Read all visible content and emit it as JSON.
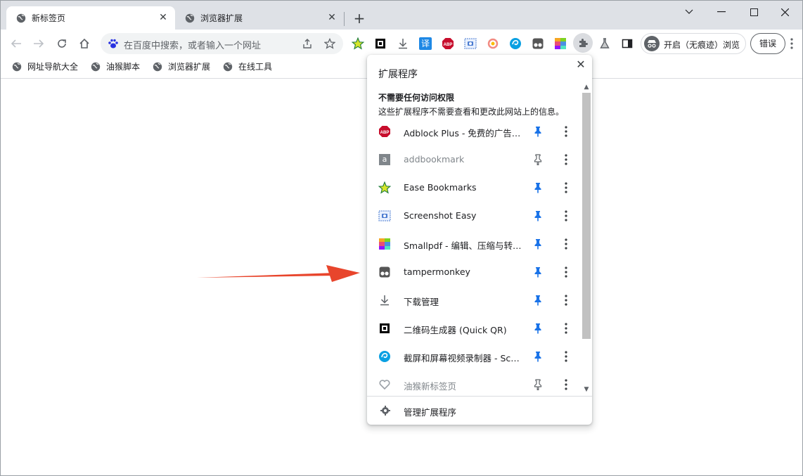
{
  "tabs": [
    {
      "title": "新标签页",
      "active": true
    },
    {
      "title": "浏览器扩展",
      "active": false
    }
  ],
  "omnibox": {
    "placeholder": "在百度中搜索，或者输入一个网址"
  },
  "profile": {
    "label": "开启（无痕迹）浏览"
  },
  "error_button": {
    "label": "错误"
  },
  "bookmarks": [
    "网址导航大全",
    "油猴脚本",
    "浏览器扩展",
    "在线工具"
  ],
  "toolbar_extensions": [
    "ease-bookmarks-icon",
    "quick-qr-icon",
    "download-icon",
    "translate-icon",
    "adblock-plus-icon",
    "screenshot-easy-icon",
    "record-icon",
    "screen-recorder-icon",
    "tampermonkey-icon",
    "smallpdf-icon",
    "extensions-puzzle-icon",
    "beaker-icon",
    "sidepanel-icon"
  ],
  "translate_glyph": "译",
  "popup": {
    "title": "扩展程序",
    "section_title": "不需要任何访问权限",
    "section_desc": "这些扩展程序不需要查看和更改此网站上的信息。",
    "manage_label": "管理扩展程序",
    "items": [
      {
        "label": "Adblock Plus - 免费的广告…",
        "icon": "adblock-plus-icon",
        "pinned": true,
        "dim": false
      },
      {
        "label": "addbookmark",
        "icon": "addbookmark-icon",
        "pinned": false,
        "dim": true
      },
      {
        "label": "Ease Bookmarks",
        "icon": "star-icon",
        "pinned": true,
        "dim": false
      },
      {
        "label": "Screenshot Easy",
        "icon": "camera-icon",
        "pinned": true,
        "dim": false
      },
      {
        "label": "Smallpdf - 编辑、压缩与转…",
        "icon": "smallpdf-icon",
        "pinned": true,
        "dim": false
      },
      {
        "label": "tampermonkey",
        "icon": "tampermonkey-icon",
        "pinned": true,
        "dim": false
      },
      {
        "label": "下载管理",
        "icon": "download-icon",
        "pinned": true,
        "dim": false
      },
      {
        "label": "二维码生成器 (Quick QR)",
        "icon": "qr-icon",
        "pinned": true,
        "dim": false
      },
      {
        "label": "截屏和屏幕视频录制器 - Sc…",
        "icon": "screen-recorder-icon",
        "pinned": true,
        "dim": false
      },
      {
        "label": "油猴新标签页",
        "icon": "heart-icon",
        "pinned": false,
        "dim": true
      }
    ],
    "addbookmark_glyph": "a",
    "abp_glyph": "ABP"
  },
  "colors": {
    "accent": "#1a73e8",
    "arrow": "#e8452c",
    "tab_bar": "#dee1e6"
  }
}
